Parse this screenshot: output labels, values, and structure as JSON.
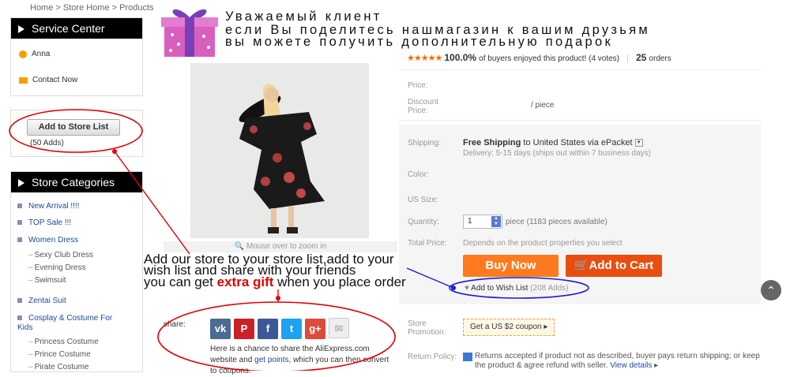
{
  "breadcrumb": {
    "items": [
      "Home",
      "Store Home",
      "Products"
    ],
    "sep": " > "
  },
  "sidebar": {
    "service_title": "Service Center",
    "agent_name": "Anna",
    "contact_label": "Contact Now",
    "add_store_label": "Add to Store List",
    "adds_count": "(50 Adds)",
    "categories_title": "Store Categories",
    "categories": [
      {
        "label": "New Arrival !!!!",
        "sub": false
      },
      {
        "label": "TOP Sale !!!",
        "sub": false
      },
      {
        "label": "Women Dress",
        "sub": false
      },
      {
        "label": "Sexy Club Dress",
        "sub": true
      },
      {
        "label": "Evening Dress",
        "sub": true
      },
      {
        "label": "Swimsuit",
        "sub": true
      },
      {
        "label": "Zentai Suit",
        "sub": false
      },
      {
        "label": "Cosplay & Costume For Kids",
        "sub": false
      },
      {
        "label": "Princess Costume",
        "sub": true
      },
      {
        "label": "Prince Costume",
        "sub": true
      },
      {
        "label": "Pirate Costume",
        "sub": true
      }
    ]
  },
  "banner": {
    "line1": "Уважаемый клиент",
    "line2": "если Вы поделитесь нашмагазин к вашим друзьям",
    "line3": "вы можете получить дополнительную подарок"
  },
  "rating": {
    "stars": "★★★★★",
    "percent": "100.0%",
    "text": "of buyers enjoyed this product! (4 votes)",
    "orders_count": "25",
    "orders_label": "orders"
  },
  "product": {
    "zoom_hint": "Mouse over to zoom in",
    "price_label": "Price:",
    "discount_label": "Discount Price:",
    "per_piece": "/ piece",
    "shipping_label": "Shipping:",
    "shipping_free": "Free Shipping",
    "shipping_to": "to",
    "shipping_dest": "United States via ePacket",
    "delivery": "Delivery: 5-15 days (ships out within 7 business days)",
    "color_label": "Color:",
    "size_label": "US Size:",
    "quantity_label": "Quantity:",
    "quantity_value": "1",
    "quantity_unit": "piece (1183 pieces available)",
    "total_label": "Total Price:",
    "total_value": "Depends on the product properties you select",
    "buy_now": "Buy Now",
    "add_cart": "Add to Cart",
    "wishlist": "Add to Wish List",
    "wishlist_count": "(208 Adds)",
    "promo_label": "Store Promotion:",
    "coupon": "Get a US $2 coupon",
    "return_label": "Return Policy:",
    "return_text": "Returns accepted if product not as described, buyer pays return shipping; or keep the product & agree refund with seller.",
    "view_details": "View details"
  },
  "share": {
    "label": "share:",
    "icons": [
      "vk-icon",
      "pinterest-icon",
      "facebook-icon",
      "twitter-icon",
      "googleplus-icon",
      "email-icon"
    ],
    "text1": "Here is a chance to share the AliExpress.com",
    "text2a": "website and",
    "text2link": "get points",
    "text2b": ", which you can then convert",
    "text3": "to coupons."
  },
  "annotation": {
    "line1": "Add our store to your store list,add to your",
    "line2": "wish list and share with your friends",
    "line3a": "you can get",
    "line3gift": "extra gift",
    "line3b": "when you place order"
  },
  "colors": {
    "accent_red": "#e30000",
    "annot_blue": "#1a1ad8",
    "buy": "#ff7a1e",
    "cart": "#e94e10"
  }
}
